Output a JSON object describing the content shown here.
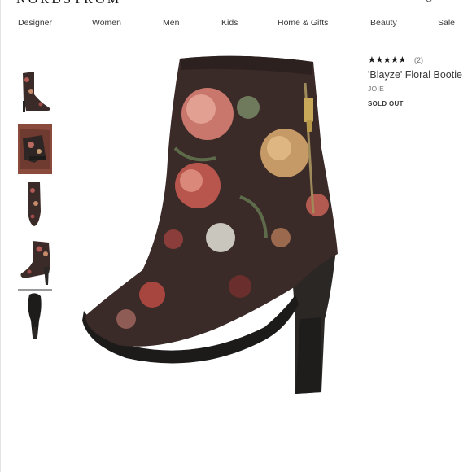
{
  "brand": {
    "logo_text": "NORDSTROM"
  },
  "nav": {
    "items": [
      "Designer",
      "Women",
      "Men",
      "Kids",
      "Home & Gifts",
      "Beauty",
      "Sale"
    ]
  },
  "product": {
    "rating_stars": "★★★★★",
    "rating_value": 5,
    "review_count": "(2)",
    "title": "'Blayze' Floral Bootie",
    "brand": "JOIE",
    "status": "SOLD OUT"
  },
  "gallery": {
    "thumbnail_count": 5,
    "selected_index": 3
  },
  "colors": {
    "text": "#393939",
    "muted": "#6f6f6f",
    "boot_base": "#3a2a28",
    "heel": "#2a2725"
  }
}
